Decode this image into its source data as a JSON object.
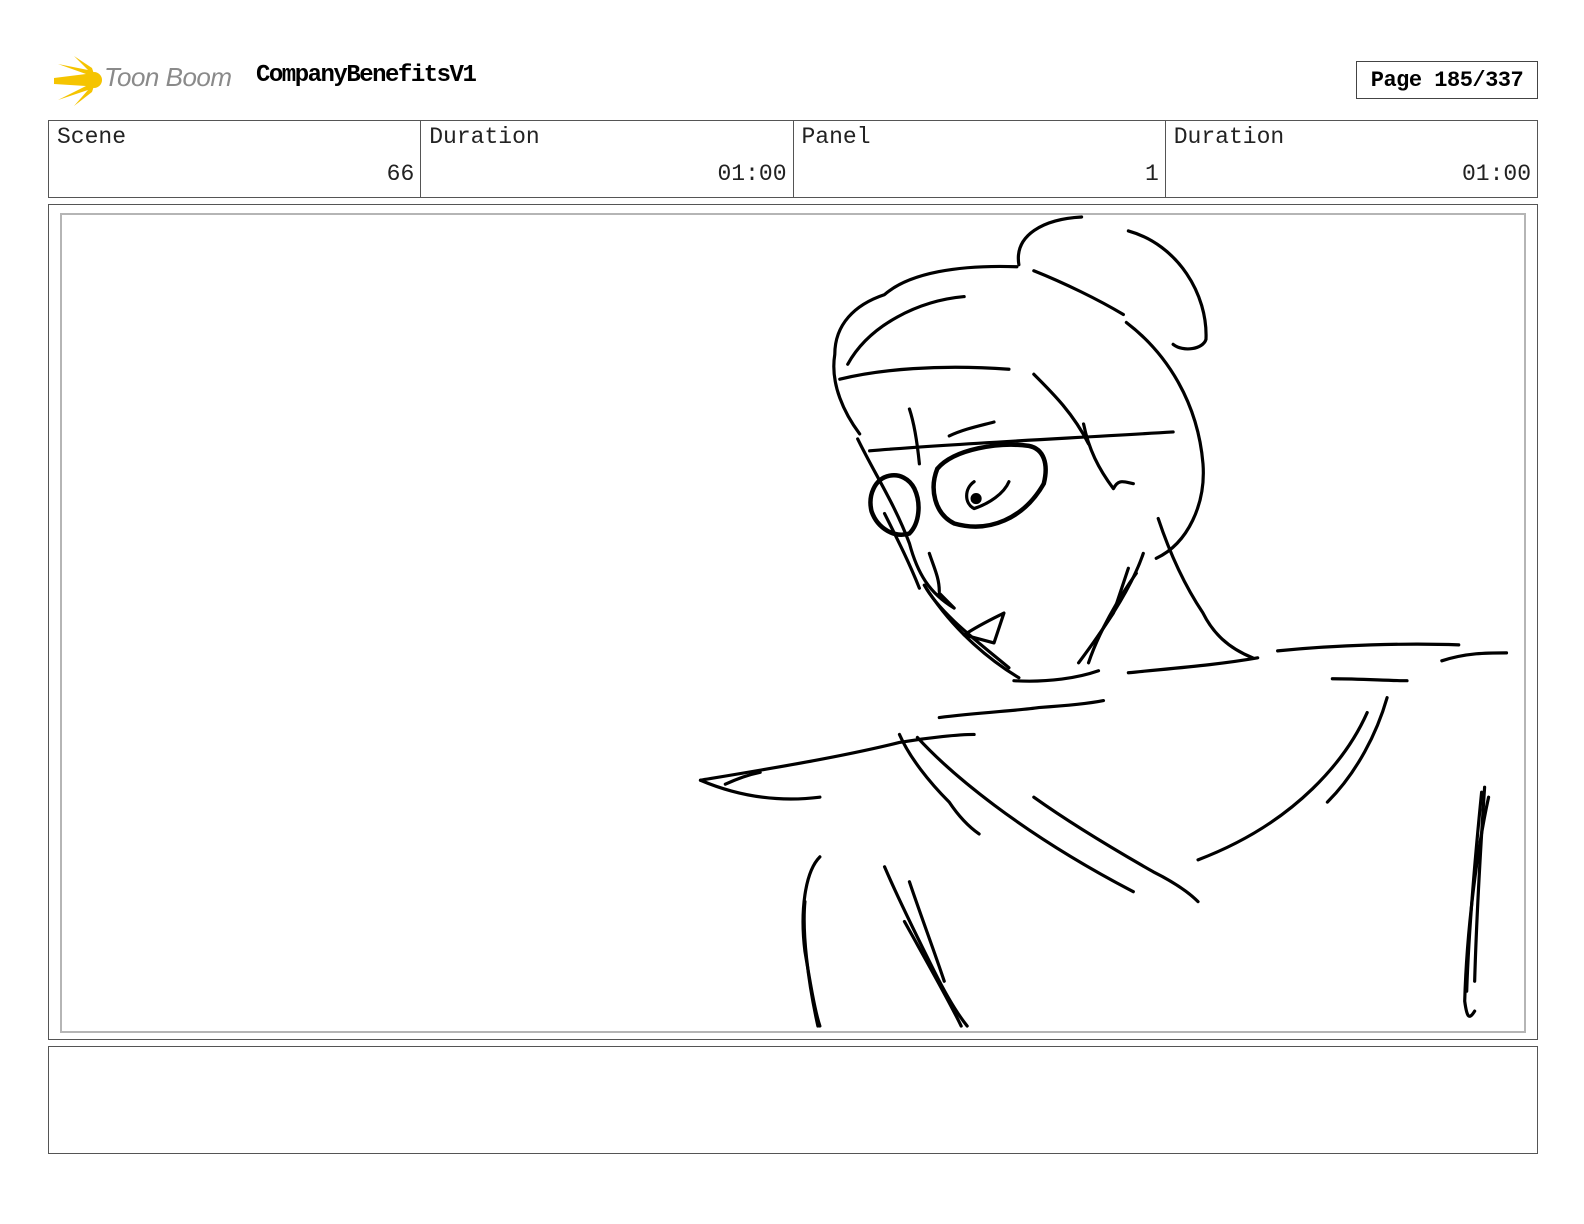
{
  "header": {
    "logo_text": "Toon Boom",
    "project_title": "CompanyBenefitsV1",
    "page_label": "Page 185/337"
  },
  "info": {
    "scene_label": "Scene",
    "scene_value": "66",
    "scene_duration_label": "Duration",
    "scene_duration_value": "01:00",
    "panel_label": "Panel",
    "panel_value": "1",
    "panel_duration_label": "Duration",
    "panel_duration_value": "01:00"
  },
  "colors": {
    "logo_accent": "#f5c400",
    "logo_text": "#8a8a8a",
    "border": "#555555",
    "sketch_ink": "#000000"
  },
  "panel": {
    "illustration": "sketch-figure-with-glasses"
  },
  "notes": {
    "text": ""
  }
}
